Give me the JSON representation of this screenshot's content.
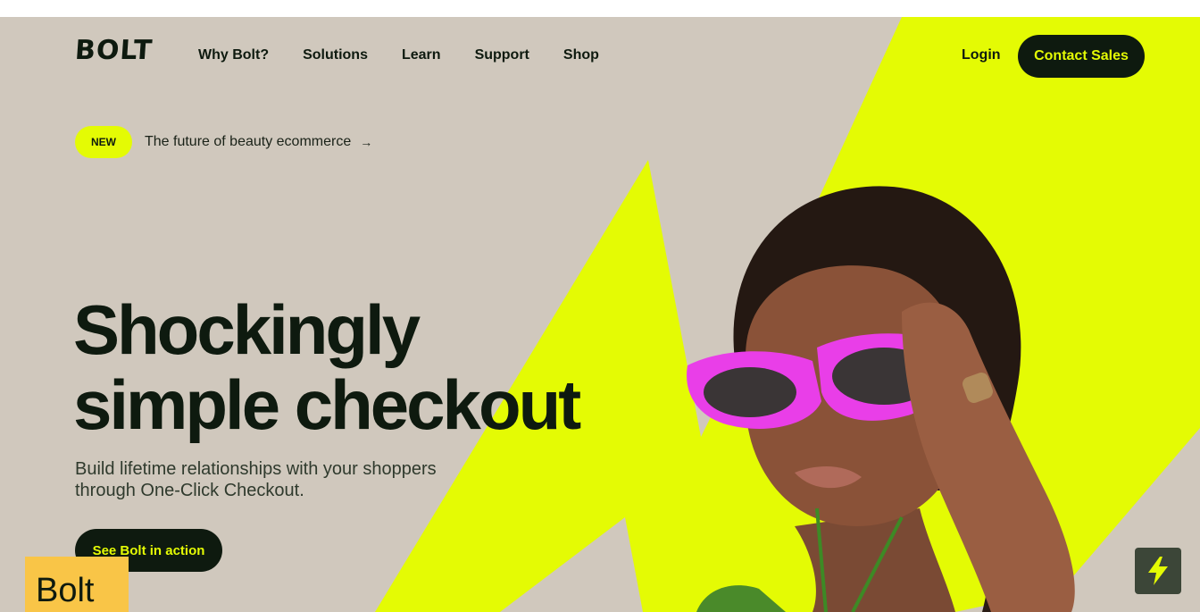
{
  "brand": {
    "logo": "BOLT",
    "accent": "#e4fb04",
    "dark": "#0e1a0f",
    "background": "#d0c8bd"
  },
  "nav": {
    "items": [
      {
        "label": "Why Bolt?"
      },
      {
        "label": "Solutions"
      },
      {
        "label": "Learn"
      },
      {
        "label": "Support"
      },
      {
        "label": "Shop"
      }
    ],
    "login_label": "Login",
    "contact_label": "Contact Sales"
  },
  "announcement": {
    "badge": "NEW",
    "text": "The future of beauty ecommerce",
    "arrow": "→"
  },
  "hero": {
    "headline_line1": "Shockingly",
    "headline_line2": "simple checkout",
    "subtitle_line1": "Build lifetime relationships with your shoppers",
    "subtitle_line2": "through One-Click Checkout.",
    "cta_label": "See Bolt in action"
  },
  "overlay": {
    "tag_label": "Bolt",
    "fab_icon": "lightning-icon"
  }
}
